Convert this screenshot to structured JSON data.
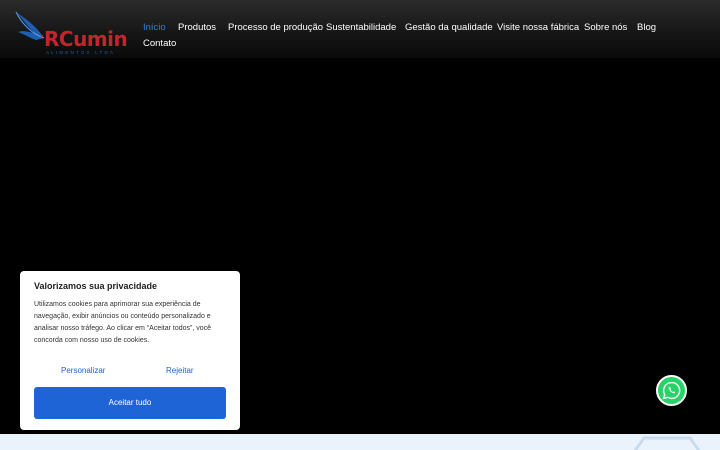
{
  "header": {
    "logo": {
      "word": "RCumin",
      "subtitle": "ALIMENTOS LTDA"
    },
    "nav": [
      {
        "label": "Início",
        "active": true
      },
      {
        "label": "Produtos"
      },
      {
        "label": "Processo de produção"
      },
      {
        "label": "Sustentabilidade"
      },
      {
        "label": "Gestão da qualidade"
      },
      {
        "label": "Visite nossa fábrica"
      },
      {
        "label": "Sobre nós"
      },
      {
        "label": "Blog"
      },
      {
        "label": "Contato"
      }
    ]
  },
  "cookie": {
    "title": "Valorizamos sua privacidade",
    "text": "Utilizamos cookies para aprimorar sua experiência de navegação, exibir anúncios ou conteúdo personalizado e analisar nosso tráfego. Ao clicar em “Aceitar todos”, você concorda com nosso uso de cookies.",
    "customize_label": "Personalizar",
    "reject_label": "Rejeitar",
    "accept_label": "Aceitar tudo"
  },
  "colors": {
    "accent": "#1f64d6",
    "nav_active": "#2f7fe0",
    "logo_red": "#c0262d",
    "whatsapp": "#25d366"
  },
  "icons": {
    "whatsapp": "whatsapp-icon",
    "logo": "bird-logo-icon"
  }
}
